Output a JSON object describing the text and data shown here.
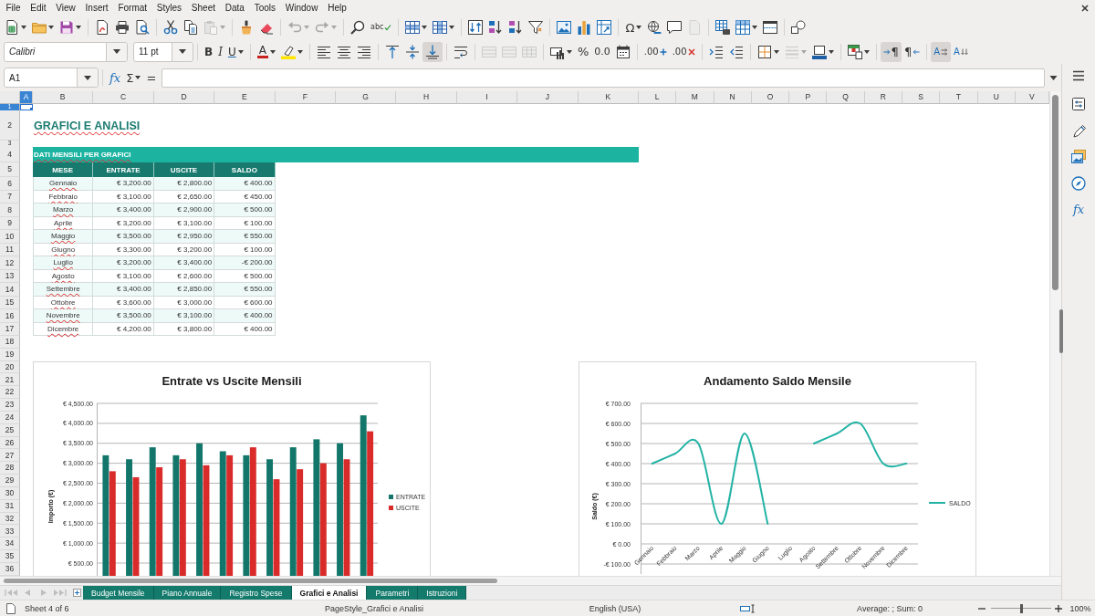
{
  "menu": [
    "File",
    "Edit",
    "View",
    "Insert",
    "Format",
    "Styles",
    "Sheet",
    "Data",
    "Tools",
    "Window",
    "Help"
  ],
  "standard_toolbar": [
    [
      {
        "dropdown": true,
        "disabled": false
      },
      {
        "dropdown": true,
        "disabled": false
      },
      {
        "dropdown": true,
        "disabled": false
      }
    ],
    [
      {
        "dropdown": false,
        "disabled": false
      },
      {
        "dropdown": false,
        "disabled": false
      },
      {
        "dropdown": false,
        "disabled": false
      }
    ],
    [
      {
        "dropdown": false,
        "disabled": false
      },
      {
        "dropdown": false,
        "disabled": false
      },
      {
        "dropdown": true,
        "disabled": true
      }
    ],
    [
      {
        "dropdown": false,
        "disabled": false
      },
      {
        "dropdown": false,
        "disabled": false
      }
    ],
    [
      {
        "dropdown": true,
        "disabled": true
      },
      {
        "dropdown": true,
        "disabled": true
      }
    ],
    [
      {
        "dropdown": false,
        "disabled": false
      },
      {
        "glyph": "abc",
        "dropdown": false,
        "disabled": false
      }
    ],
    [
      {
        "dropdown": true,
        "disabled": false
      },
      {
        "dropdown": true,
        "disabled": false
      }
    ],
    [
      {
        "dropdown": false,
        "disabled": false
      },
      {
        "dropdown": false,
        "disabled": false
      },
      {
        "dropdown": false,
        "disabled": false
      },
      {
        "dropdown": false,
        "disabled": false
      }
    ],
    [
      {
        "dropdown": false,
        "disabled": false
      },
      {
        "dropdown": false,
        "disabled": false
      },
      {
        "dropdown": false,
        "disabled": false
      }
    ],
    [
      {
        "glyph": "Ω",
        "dropdown": true,
        "disabled": false
      },
      {
        "dropdown": false,
        "disabled": false
      },
      {
        "dropdown": false,
        "disabled": false
      },
      {
        "dropdown": false,
        "disabled": true
      }
    ],
    [
      {
        "dropdown": false,
        "disabled": false
      },
      {
        "dropdown": true,
        "disabled": false
      },
      {
        "dropdown": false,
        "disabled": false
      }
    ],
    [
      {
        "dropdown": false,
        "disabled": false
      }
    ]
  ],
  "formatting_toolbar": {
    "font_name": "Calibri",
    "font_size": "11 pt",
    "buttons": [
      [
        {
          "glyph": "B",
          "pressed": false,
          "disabled": false,
          "dropdown": false
        },
        {
          "glyph": "I",
          "pressed": false,
          "disabled": false,
          "dropdown": false
        },
        {
          "glyph": "U",
          "pressed": false,
          "disabled": false,
          "dropdown": true
        }
      ],
      [
        {
          "glyph": "A",
          "pressed": false,
          "disabled": false,
          "dropdown": true
        },
        {
          "pressed": false,
          "disabled": false,
          "dropdown": true
        }
      ],
      [
        {
          "pressed": false,
          "disabled": false,
          "dropdown": false
        },
        {
          "pressed": false,
          "disabled": false,
          "dropdown": false
        },
        {
          "pressed": false,
          "disabled": false,
          "dropdown": false
        }
      ],
      [
        {
          "pressed": false,
          "disabled": false,
          "dropdown": false
        },
        {
          "pressed": false,
          "disabled": false,
          "dropdown": false
        },
        {
          "pressed": true,
          "disabled": false,
          "dropdown": false
        }
      ],
      [
        {
          "pressed": false,
          "disabled": false,
          "dropdown": false
        }
      ],
      [
        {
          "pressed": false,
          "disabled": true,
          "dropdown": false
        },
        {
          "pressed": false,
          "disabled": true,
          "dropdown": false
        },
        {
          "pressed": false,
          "disabled": true,
          "dropdown": false
        }
      ],
      [
        {
          "pressed": false,
          "disabled": false,
          "dropdown": true
        },
        {
          "glyph": "%",
          "pressed": false,
          "disabled": false,
          "dropdown": false
        },
        {
          "glyph": "0.0",
          "pressed": false,
          "disabled": false,
          "dropdown": false
        },
        {
          "pressed": false,
          "disabled": false,
          "dropdown": false
        }
      ],
      [
        {
          "glyph": ".00",
          "pressed": false,
          "disabled": false,
          "dropdown": false
        },
        {
          "glyph": ".00",
          "pressed": false,
          "disabled": false,
          "dropdown": false
        }
      ],
      [
        {
          "pressed": false,
          "disabled": false,
          "dropdown": false
        },
        {
          "pressed": false,
          "disabled": false,
          "dropdown": false
        }
      ],
      [
        {
          "pressed": false,
          "disabled": false,
          "dropdown": true
        },
        {
          "pressed": false,
          "disabled": true,
          "dropdown": true
        },
        {
          "pressed": false,
          "disabled": false,
          "dropdown": true
        }
      ],
      [
        {
          "pressed": false,
          "disabled": false,
          "dropdown": true
        }
      ],
      [
        {
          "glyph": "¶",
          "pressed": true,
          "disabled": false,
          "dropdown": false
        },
        {
          "glyph": "¶",
          "pressed": false,
          "disabled": false,
          "dropdown": false
        }
      ],
      [
        {
          "glyph": "A",
          "pressed": true,
          "disabled": false,
          "dropdown": false
        },
        {
          "glyph": "A",
          "pressed": false,
          "disabled": false,
          "dropdown": false
        }
      ]
    ]
  },
  "formula_bar": {
    "cell_reference": "A1",
    "buttons": [
      {
        "glyph": "fx",
        "dropdown": false
      },
      {
        "glyph": "Σ",
        "dropdown": true
      },
      {
        "glyph": "=",
        "dropdown": false
      }
    ]
  },
  "sidebar": {
    "functions_glyph": "fx"
  },
  "columns": [
    {
      "label": "A",
      "selected": true
    },
    {
      "label": "B",
      "selected": false
    },
    {
      "label": "C",
      "selected": false
    },
    {
      "label": "D",
      "selected": false
    },
    {
      "label": "E",
      "selected": false
    },
    {
      "label": "F",
      "selected": false
    },
    {
      "label": "G",
      "selected": false
    },
    {
      "label": "H",
      "selected": false
    },
    {
      "label": "I",
      "selected": false
    },
    {
      "label": "J",
      "selected": false
    },
    {
      "label": "K",
      "selected": false
    },
    {
      "label": "L",
      "selected": false
    },
    {
      "label": "M",
      "selected": false
    },
    {
      "label": "N",
      "selected": false
    },
    {
      "label": "O",
      "selected": false
    },
    {
      "label": "P",
      "selected": false
    },
    {
      "label": "Q",
      "selected": false
    },
    {
      "label": "R",
      "selected": false
    },
    {
      "label": "S",
      "selected": false
    },
    {
      "label": "T",
      "selected": false
    },
    {
      "label": "U",
      "selected": false
    },
    {
      "label": "V",
      "selected": false
    }
  ],
  "rows": [
    {
      "label": "1",
      "selected": true
    },
    {
      "label": "2",
      "selected": false
    },
    {
      "label": "3",
      "selected": false
    },
    {
      "label": "4",
      "selected": false
    },
    {
      "label": "5",
      "selected": false
    },
    {
      "label": "6",
      "selected": false
    },
    {
      "label": "7",
      "selected": false
    },
    {
      "label": "8",
      "selected": false
    },
    {
      "label": "9",
      "selected": false
    },
    {
      "label": "10",
      "selected": false
    },
    {
      "label": "11",
      "selected": false
    },
    {
      "label": "12",
      "selected": false
    },
    {
      "label": "13",
      "selected": false
    },
    {
      "label": "14",
      "selected": false
    },
    {
      "label": "15",
      "selected": false
    },
    {
      "label": "16",
      "selected": false
    },
    {
      "label": "17",
      "selected": false
    },
    {
      "label": "18",
      "selected": false
    },
    {
      "label": "19",
      "selected": false
    },
    {
      "label": "20",
      "selected": false
    },
    {
      "label": "21",
      "selected": false
    },
    {
      "label": "22",
      "selected": false
    },
    {
      "label": "23",
      "selected": false
    },
    {
      "label": "24",
      "selected": false
    },
    {
      "label": "25",
      "selected": false
    },
    {
      "label": "26",
      "selected": false
    },
    {
      "label": "27",
      "selected": false
    },
    {
      "label": "28",
      "selected": false
    },
    {
      "label": "29",
      "selected": false
    },
    {
      "label": "30",
      "selected": false
    },
    {
      "label": "31",
      "selected": false
    },
    {
      "label": "32",
      "selected": false
    },
    {
      "label": "33",
      "selected": false
    },
    {
      "label": "34",
      "selected": false
    },
    {
      "label": "35",
      "selected": false
    },
    {
      "label": "36",
      "selected": false
    }
  ],
  "sheet": {
    "autospell": true,
    "title": "GRAFICI E ANALISI",
    "section": "DATI MENSILI PER GRAFICI",
    "table": {
      "columns": [
        "MESE",
        "ENTRATE",
        "USCITE",
        "SALDO"
      ],
      "rows": [
        [
          "Gennaio",
          "€ 3,200.00",
          "€ 2,800.00",
          "€ 400.00"
        ],
        [
          "Febbraio",
          "€ 3,100.00",
          "€ 2,650.00",
          "€ 450.00"
        ],
        [
          "Marzo",
          "€ 3,400.00",
          "€ 2,900.00",
          "€ 500.00"
        ],
        [
          "Aprile",
          "€ 3,200.00",
          "€ 3,100.00",
          "€ 100.00"
        ],
        [
          "Maggio",
          "€ 3,500.00",
          "€ 2,950.00",
          "€ 550.00"
        ],
        [
          "Giugno",
          "€ 3,300.00",
          "€ 3,200.00",
          "€ 100.00"
        ],
        [
          "Luglio",
          "€ 3,200.00",
          "€ 3,400.00",
          "-€ 200.00"
        ],
        [
          "Agosto",
          "€ 3,100.00",
          "€ 2,600.00",
          "€ 500.00"
        ],
        [
          "Settembre",
          "€ 3,400.00",
          "€ 2,850.00",
          "€ 550.00"
        ],
        [
          "Ottobre",
          "€ 3,600.00",
          "€ 3,000.00",
          "€ 600.00"
        ],
        [
          "Novembre",
          "€ 3,500.00",
          "€ 3,100.00",
          "€ 400.00"
        ],
        [
          "Dicembre",
          "€ 4,200.00",
          "€ 3,800.00",
          "€ 400.00"
        ]
      ]
    },
    "charts": [
      {
        "chart_data": {
          "type": "bar",
          "title": "Entrate vs Uscite Mensili",
          "ylabel": "Importo (€)",
          "grid": true,
          "legend": "right",
          "series": [
            {
              "name": "ENTRATE",
              "color": "#13766a",
              "values": [
                3200,
                3100,
                3400,
                3200,
                3500,
                3300,
                3200,
                3100,
                3400,
                3600,
                3500,
                4200
              ]
            },
            {
              "name": "USCITE",
              "color": "#da2b2b",
              "values": [
                2800,
                2650,
                2900,
                3100,
                2950,
                3200,
                3400,
                2600,
                2850,
                3000,
                3100,
                3800
              ]
            }
          ],
          "ylim": [
            0,
            4500
          ],
          "yticks": [
            {
              "value": 500,
              "label": "€ 500.00"
            },
            {
              "value": 1000,
              "label": "€ 1,000.00"
            },
            {
              "value": 1500,
              "label": "€ 1,500.00"
            },
            {
              "value": 2000,
              "label": "€ 2,000.00"
            },
            {
              "value": 2500,
              "label": "€ 2,500.00"
            },
            {
              "value": 3000,
              "label": "€ 3,000.00"
            },
            {
              "value": 3500,
              "label": "€ 3,500.00"
            },
            {
              "value": 4000,
              "label": "€ 4,000.00"
            },
            {
              "value": 4500,
              "label": "€ 4,500.00"
            }
          ]
        }
      },
      {
        "chart_data": {
          "type": "line",
          "title": "Andamento Saldo Mensile",
          "ylabel": "Saldo (€)",
          "grid": true,
          "legend": "right",
          "categories": [
            "Gennaio",
            "Febbraio",
            "Marzo",
            "Aprile",
            "Maggio",
            "Giugno",
            "Luglio",
            "Agosto",
            "Settembre",
            "Ottobre",
            "Novembre",
            "Dicembre"
          ],
          "series": [
            {
              "name": "SALDO",
              "color": "#22b3a5",
              "values": [
                400,
                450,
                500,
                100,
                550,
                100,
                null,
                500,
                550,
                600,
                400,
                400
              ]
            }
          ],
          "ylim": [
            -150,
            700
          ],
          "yticks": [
            {
              "value": -100,
              "label": "-€ 100.00"
            },
            {
              "value": 0,
              "label": "€ 0.00"
            },
            {
              "value": 100,
              "label": "€ 100.00"
            },
            {
              "value": 200,
              "label": "€ 200.00"
            },
            {
              "value": 300,
              "label": "€ 300.00"
            },
            {
              "value": 400,
              "label": "€ 400.00"
            },
            {
              "value": 500,
              "label": "€ 500.00"
            },
            {
              "value": 600,
              "label": "€ 600.00"
            },
            {
              "value": 700,
              "label": "€ 700.00"
            }
          ]
        }
      }
    ]
  },
  "sheet_navigation": [
    {
      "disabled": true
    },
    {
      "disabled": true
    },
    {
      "disabled": true
    },
    {
      "disabled": true
    }
  ],
  "sheet_tabs": [
    {
      "label": "Budget Mensile",
      "selected": false
    },
    {
      "label": "Piano Annuale",
      "selected": false
    },
    {
      "label": "Registro Spese",
      "selected": false
    },
    {
      "label": "Grafici e Analisi",
      "selected": true
    },
    {
      "label": "Parametri",
      "selected": false
    },
    {
      "label": "Istruzioni",
      "selected": false
    }
  ],
  "status_bar": {
    "sheet": "Sheet 4 of 6",
    "page_style": "PageStyle_Grafici e Analisi",
    "language": "English (USA)",
    "selection": "Average: ; Sum: 0",
    "zoom": {
      "level": 0.5,
      "reading": "100%"
    }
  }
}
